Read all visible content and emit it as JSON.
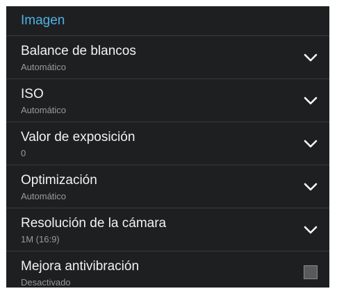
{
  "section": {
    "title": "Imagen"
  },
  "settings": [
    {
      "label": "Balance de blancos",
      "value": "Automático",
      "control": "chevron-down-icon"
    },
    {
      "label": "ISO",
      "value": "Automático",
      "control": "chevron-down-icon"
    },
    {
      "label": "Valor de exposición",
      "value": "0",
      "control": "chevron-down-icon"
    },
    {
      "label": "Optimización",
      "value": "Automático",
      "control": "chevron-down-icon"
    },
    {
      "label": "Resolución de la cámara",
      "value": "1M (16:9)",
      "control": "chevron-down-icon"
    },
    {
      "label": "Mejora antivibración",
      "value": "Desactivado",
      "control": "checkbox",
      "checked": false
    }
  ],
  "colors": {
    "background": "#1e1f21",
    "accent": "#4fb3e6",
    "label": "#f2f2f2",
    "value": "#9a9a9a",
    "divider": "#3a3b3d"
  }
}
